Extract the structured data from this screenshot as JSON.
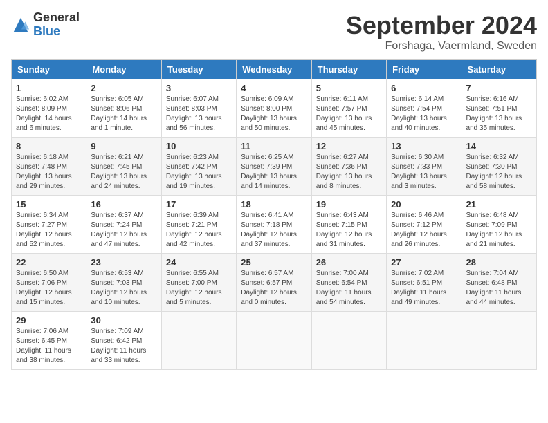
{
  "header": {
    "logo_general": "General",
    "logo_blue": "Blue",
    "title": "September 2024",
    "location": "Forshaga, Vaermland, Sweden"
  },
  "days_of_week": [
    "Sunday",
    "Monday",
    "Tuesday",
    "Wednesday",
    "Thursday",
    "Friday",
    "Saturday"
  ],
  "weeks": [
    [
      {
        "num": "1",
        "sunrise": "6:02 AM",
        "sunset": "8:09 PM",
        "daylight": "14 hours and 6 minutes."
      },
      {
        "num": "2",
        "sunrise": "6:05 AM",
        "sunset": "8:06 PM",
        "daylight": "14 hours and 1 minute."
      },
      {
        "num": "3",
        "sunrise": "6:07 AM",
        "sunset": "8:03 PM",
        "daylight": "13 hours and 56 minutes."
      },
      {
        "num": "4",
        "sunrise": "6:09 AM",
        "sunset": "8:00 PM",
        "daylight": "13 hours and 50 minutes."
      },
      {
        "num": "5",
        "sunrise": "6:11 AM",
        "sunset": "7:57 PM",
        "daylight": "13 hours and 45 minutes."
      },
      {
        "num": "6",
        "sunrise": "6:14 AM",
        "sunset": "7:54 PM",
        "daylight": "13 hours and 40 minutes."
      },
      {
        "num": "7",
        "sunrise": "6:16 AM",
        "sunset": "7:51 PM",
        "daylight": "13 hours and 35 minutes."
      }
    ],
    [
      {
        "num": "8",
        "sunrise": "6:18 AM",
        "sunset": "7:48 PM",
        "daylight": "13 hours and 29 minutes."
      },
      {
        "num": "9",
        "sunrise": "6:21 AM",
        "sunset": "7:45 PM",
        "daylight": "13 hours and 24 minutes."
      },
      {
        "num": "10",
        "sunrise": "6:23 AM",
        "sunset": "7:42 PM",
        "daylight": "13 hours and 19 minutes."
      },
      {
        "num": "11",
        "sunrise": "6:25 AM",
        "sunset": "7:39 PM",
        "daylight": "13 hours and 14 minutes."
      },
      {
        "num": "12",
        "sunrise": "6:27 AM",
        "sunset": "7:36 PM",
        "daylight": "13 hours and 8 minutes."
      },
      {
        "num": "13",
        "sunrise": "6:30 AM",
        "sunset": "7:33 PM",
        "daylight": "13 hours and 3 minutes."
      },
      {
        "num": "14",
        "sunrise": "6:32 AM",
        "sunset": "7:30 PM",
        "daylight": "12 hours and 58 minutes."
      }
    ],
    [
      {
        "num": "15",
        "sunrise": "6:34 AM",
        "sunset": "7:27 PM",
        "daylight": "12 hours and 52 minutes."
      },
      {
        "num": "16",
        "sunrise": "6:37 AM",
        "sunset": "7:24 PM",
        "daylight": "12 hours and 47 minutes."
      },
      {
        "num": "17",
        "sunrise": "6:39 AM",
        "sunset": "7:21 PM",
        "daylight": "12 hours and 42 minutes."
      },
      {
        "num": "18",
        "sunrise": "6:41 AM",
        "sunset": "7:18 PM",
        "daylight": "12 hours and 37 minutes."
      },
      {
        "num": "19",
        "sunrise": "6:43 AM",
        "sunset": "7:15 PM",
        "daylight": "12 hours and 31 minutes."
      },
      {
        "num": "20",
        "sunrise": "6:46 AM",
        "sunset": "7:12 PM",
        "daylight": "12 hours and 26 minutes."
      },
      {
        "num": "21",
        "sunrise": "6:48 AM",
        "sunset": "7:09 PM",
        "daylight": "12 hours and 21 minutes."
      }
    ],
    [
      {
        "num": "22",
        "sunrise": "6:50 AM",
        "sunset": "7:06 PM",
        "daylight": "12 hours and 15 minutes."
      },
      {
        "num": "23",
        "sunrise": "6:53 AM",
        "sunset": "7:03 PM",
        "daylight": "12 hours and 10 minutes."
      },
      {
        "num": "24",
        "sunrise": "6:55 AM",
        "sunset": "7:00 PM",
        "daylight": "12 hours and 5 minutes."
      },
      {
        "num": "25",
        "sunrise": "6:57 AM",
        "sunset": "6:57 PM",
        "daylight": "12 hours and 0 minutes."
      },
      {
        "num": "26",
        "sunrise": "7:00 AM",
        "sunset": "6:54 PM",
        "daylight": "11 hours and 54 minutes."
      },
      {
        "num": "27",
        "sunrise": "7:02 AM",
        "sunset": "6:51 PM",
        "daylight": "11 hours and 49 minutes."
      },
      {
        "num": "28",
        "sunrise": "7:04 AM",
        "sunset": "6:48 PM",
        "daylight": "11 hours and 44 minutes."
      }
    ],
    [
      {
        "num": "29",
        "sunrise": "7:06 AM",
        "sunset": "6:45 PM",
        "daylight": "11 hours and 38 minutes."
      },
      {
        "num": "30",
        "sunrise": "7:09 AM",
        "sunset": "6:42 PM",
        "daylight": "11 hours and 33 minutes."
      },
      null,
      null,
      null,
      null,
      null
    ]
  ]
}
